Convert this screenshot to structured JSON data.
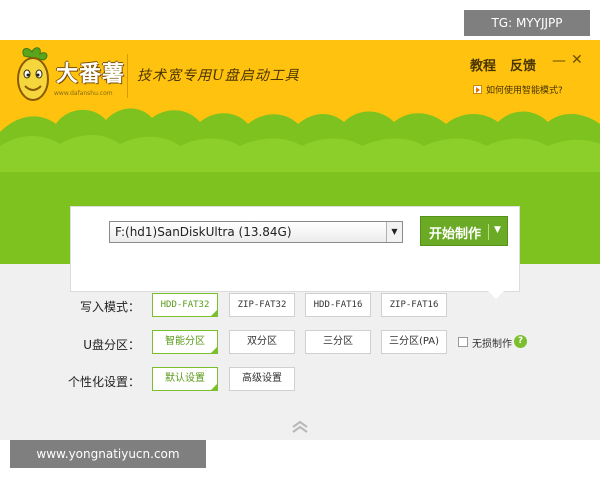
{
  "watermarks": {
    "top": "TG: MYYJJPP",
    "bottom": "www.yongnatiyucn.com"
  },
  "header": {
    "logo_text": "大番薯",
    "logo_url": "www.dafanshu.com",
    "slogan": "技术宽专用U盘启动工具",
    "nav": {
      "tutorial": "教程",
      "feedback": "反馈"
    },
    "window_controls": {
      "minimize": "—",
      "close": "✕"
    },
    "help_link": "如何使用智能模式?"
  },
  "drive": {
    "selected": "F:(hd1)SanDiskUltra (13.84G)",
    "start_button": "开始制作",
    "start_arrow": "▼"
  },
  "options": {
    "write_mode": {
      "label": "写入模式：",
      "choices": [
        "HDD-FAT32",
        "ZIP-FAT32",
        "HDD-FAT16",
        "ZIP-FAT16"
      ],
      "selected": "HDD-FAT32"
    },
    "partition": {
      "label": "U盘分区：",
      "choices": [
        "智能分区",
        "双分区",
        "三分区",
        "三分区(PA)"
      ],
      "selected": "智能分区",
      "lossless_label": "无损制作",
      "help": "?"
    },
    "personalize": {
      "label": "个性化设置：",
      "choices": [
        "默认设置",
        "高级设置"
      ],
      "selected": "默认设置"
    }
  },
  "colors": {
    "header_yellow": "#ffc20e",
    "brand_green": "#7dc21e",
    "button_green": "#6aaa24",
    "panel_bg": "#f0f0f0"
  },
  "icons": {
    "mascot": "sweet-potato-mascot-icon",
    "dropdown": "chevron-down-icon",
    "collapse": "double-chevron-up-icon",
    "help": "question-icon",
    "play": "play-icon"
  }
}
